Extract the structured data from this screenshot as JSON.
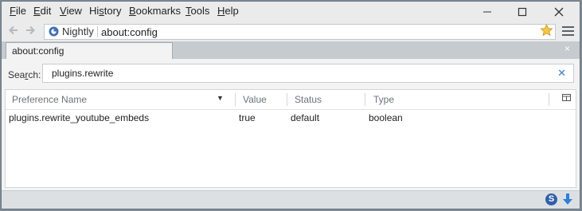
{
  "menubar": {
    "items": [
      {
        "label": "File",
        "accesskey": "F",
        "rest": "ile"
      },
      {
        "label": "Edit",
        "accesskey": "E",
        "rest": "dit"
      },
      {
        "label": "View",
        "accesskey": "V",
        "rest": "iew"
      },
      {
        "label": "History",
        "pre": "Hi",
        "accesskey": "s",
        "rest": "tory"
      },
      {
        "label": "Bookmarks",
        "accesskey": "B",
        "rest": "ookmarks"
      },
      {
        "label": "Tools",
        "accesskey": "T",
        "rest": "ools"
      },
      {
        "label": "Help",
        "accesskey": "H",
        "rest": "elp"
      }
    ]
  },
  "toolbar": {
    "identity_label": "Nightly",
    "url": "about:config",
    "icons": [
      "back-arrow-icon",
      "forward-arrow-icon",
      "globe-icon",
      "bookmark-star-icon",
      "hamburger-menu-icon"
    ]
  },
  "tab": {
    "label": "about:config",
    "close_glyph": "×"
  },
  "search": {
    "label_pre": "Sea",
    "label_key": "r",
    "label_post": "ch:",
    "value": "plugins.rewrite",
    "clear_glyph": "✕"
  },
  "table": {
    "columns": [
      "Preference Name",
      "Value",
      "Status",
      "Type"
    ],
    "rows": [
      {
        "name": "plugins.rewrite_youtube_embeds",
        "value": "true",
        "status": "default",
        "type": "boolean"
      }
    ]
  },
  "statusbar": {
    "s_icon_letter": "S"
  },
  "colors": {
    "accent": "#3b7ec3",
    "star": "#f4b62a",
    "chrome": "#ebebeb"
  }
}
